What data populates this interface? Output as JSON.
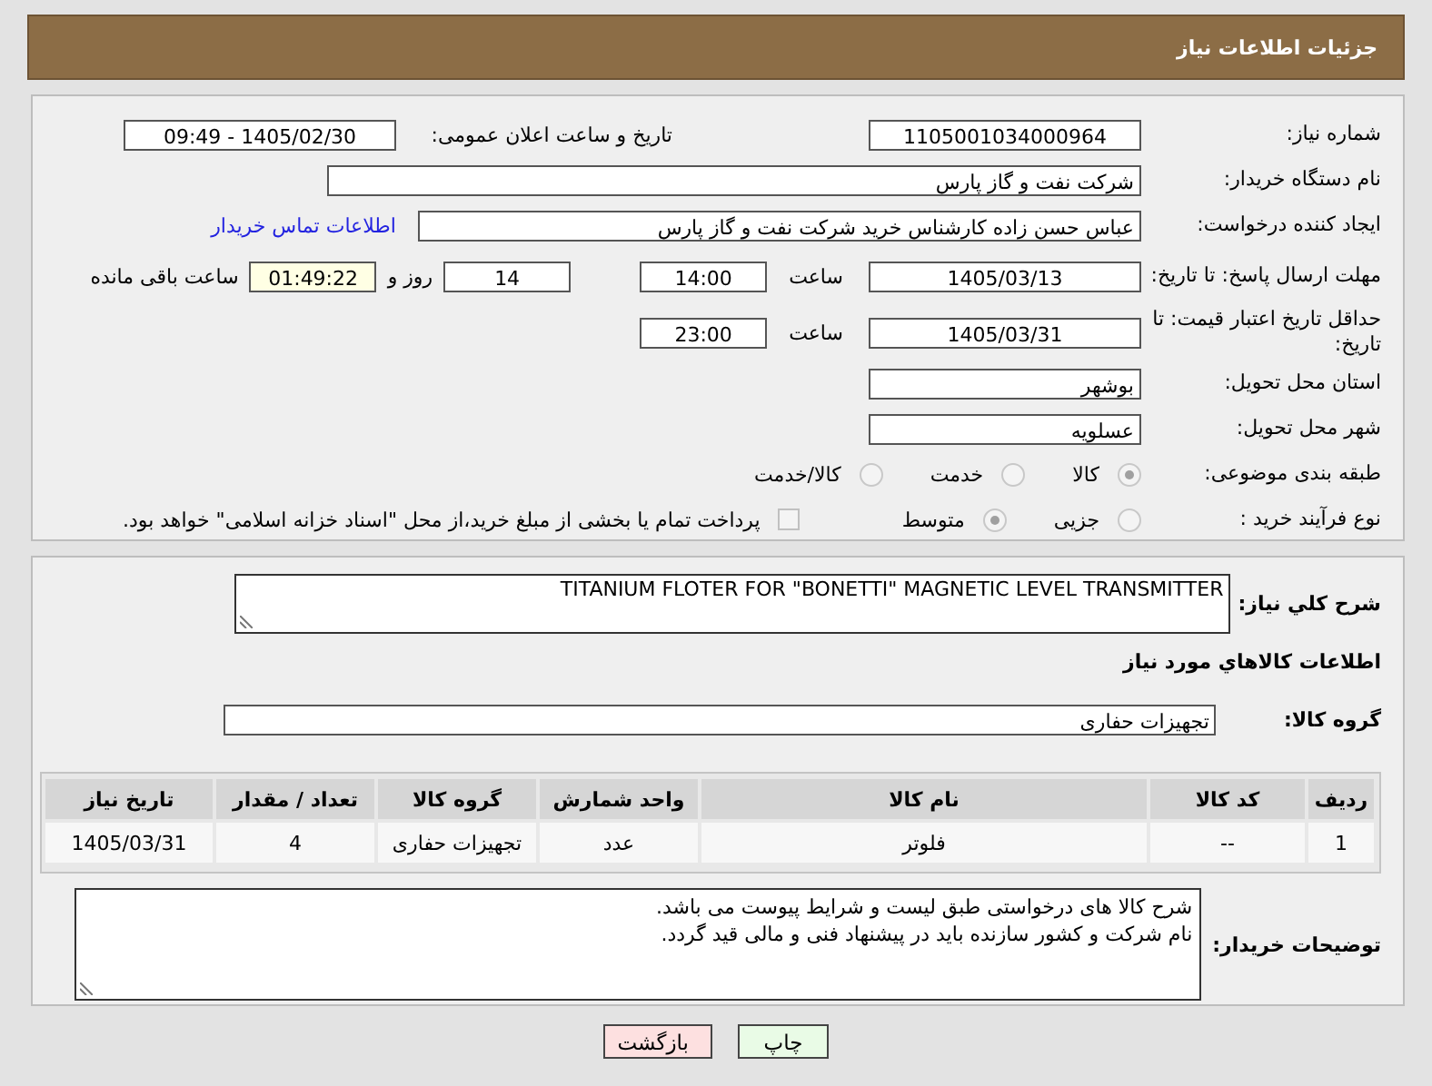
{
  "header": {
    "title": "جزئیات اطلاعات نیاز"
  },
  "need_number": {
    "label": "شماره نیاز:",
    "value": "1105001034000964"
  },
  "announce": {
    "label": "تاریخ و ساعت اعلان عمومی:",
    "value": "1405/02/30 - 09:49"
  },
  "buyer_org": {
    "label": "نام دستگاه خریدار:",
    "value": "شرکت نفت و گاز پارس"
  },
  "requester": {
    "label": "ایجاد کننده درخواست:",
    "value": "عباس حسن زاده کارشناس خرید شرکت نفت و گاز پارس",
    "link": "اطلاعات تماس خریدار"
  },
  "deadline": {
    "label": "مهلت ارسال پاسخ: تا تاریخ:",
    "date": "1405/03/13",
    "time_label": "ساعت",
    "time": "14:00",
    "days": "14",
    "days_label": "روز و",
    "remaining": "01:49:22",
    "remaining_label": "ساعت باقی مانده"
  },
  "validity": {
    "label": "حداقل تاریخ اعتبار قیمت: تا تاریخ:",
    "date": "1405/03/31",
    "time_label": "ساعت",
    "time": "23:00"
  },
  "province": {
    "label": "استان محل تحویل:",
    "value": "بوشهر"
  },
  "city": {
    "label": "شهر محل تحویل:",
    "value": "عسلویه"
  },
  "category": {
    "label": "طبقه بندی موضوعی:",
    "options": [
      {
        "label": "کالا",
        "selected": true
      },
      {
        "label": "خدمت",
        "selected": false
      },
      {
        "label": "کالا/خدمت",
        "selected": false
      }
    ]
  },
  "process": {
    "label": "نوع فرآیند خرید :",
    "options": [
      {
        "label": "جزیی",
        "selected": false
      },
      {
        "label": "متوسط",
        "selected": true
      }
    ],
    "payment": {
      "label": "پرداخت تمام یا بخشی از مبلغ خرید،از محل \"اسناد خزانه اسلامی\" خواهد بود.",
      "checked": false
    }
  },
  "description": {
    "label": "شرح كلي نياز:",
    "value": "TITANIUM FLOTER FOR \"BONETTI\"  MAGNETIC LEVEL TRANSMITTER"
  },
  "items_title": "اطلاعات كالاهاي مورد نياز",
  "goods_group": {
    "label": "گروه كالا:",
    "value": "تجهیزات حفاری"
  },
  "table": {
    "columns": [
      "رديف",
      "كد كالا",
      "نام كالا",
      "واحد شمارش",
      "گروه كالا",
      "تعداد / مقدار",
      "تاریخ نیاز"
    ],
    "rows": [
      [
        "1",
        "--",
        "فلوتر",
        "عدد",
        "تجهیزات حفاری",
        "4",
        "1405/03/31"
      ]
    ]
  },
  "buyer_notes": {
    "label": "توضیحات خریدار:",
    "lines": [
      "شرح کالا های درخواستی طبق لیست و شرایط پیوست می باشد.",
      "نام شرکت و کشور سازنده باید در پیشنهاد فنی و مالی قید گردد."
    ]
  },
  "buttons": [
    {
      "label": "چاپ",
      "kind": "print"
    },
    {
      "label": "بازگشت",
      "kind": "back"
    }
  ]
}
